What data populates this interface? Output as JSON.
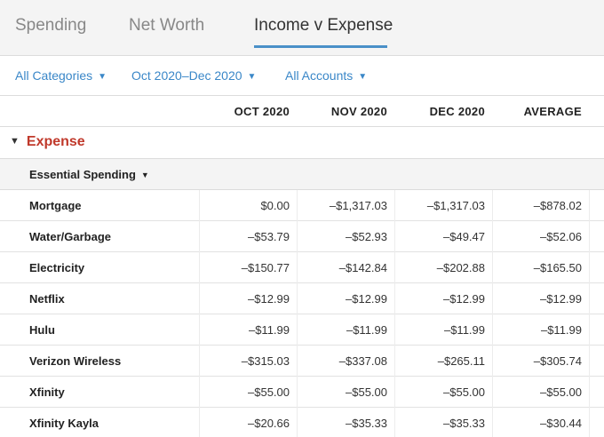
{
  "tabs": [
    {
      "label": "Spending",
      "active": false
    },
    {
      "label": "Net Worth",
      "active": false
    },
    {
      "label": "Income v Expense",
      "active": true
    }
  ],
  "filters": {
    "categories": "All Categories",
    "date_range": "Oct 2020–Dec 2020",
    "accounts": "All Accounts"
  },
  "columns": [
    "OCT 2020",
    "NOV 2020",
    "DEC 2020",
    "AVERAGE"
  ],
  "section": {
    "title": "Expense"
  },
  "group": {
    "title": "Essential Spending"
  },
  "rows": [
    {
      "label": "Mortgage",
      "values": [
        "$0.00",
        "–$1,317.03",
        "–$1,317.03",
        "–$878.02"
      ]
    },
    {
      "label": "Water/Garbage",
      "values": [
        "–$53.79",
        "–$52.93",
        "–$49.47",
        "–$52.06"
      ]
    },
    {
      "label": "Electricity",
      "values": [
        "–$150.77",
        "–$142.84",
        "–$202.88",
        "–$165.50"
      ]
    },
    {
      "label": "Netflix",
      "values": [
        "–$12.99",
        "–$12.99",
        "–$12.99",
        "–$12.99"
      ]
    },
    {
      "label": "Hulu",
      "values": [
        "–$11.99",
        "–$11.99",
        "–$11.99",
        "–$11.99"
      ]
    },
    {
      "label": "Verizon Wireless",
      "values": [
        "–$315.03",
        "–$337.08",
        "–$265.11",
        "–$305.74"
      ]
    },
    {
      "label": "Xfinity",
      "values": [
        "–$55.00",
        "–$55.00",
        "–$55.00",
        "–$55.00"
      ]
    },
    {
      "label": "Xfinity Kayla",
      "values": [
        "–$20.66",
        "–$35.33",
        "–$35.33",
        "–$30.44"
      ]
    }
  ],
  "colors": {
    "accent": "#4a90c8",
    "link": "#3a87c8",
    "expense": "#c0392b"
  }
}
